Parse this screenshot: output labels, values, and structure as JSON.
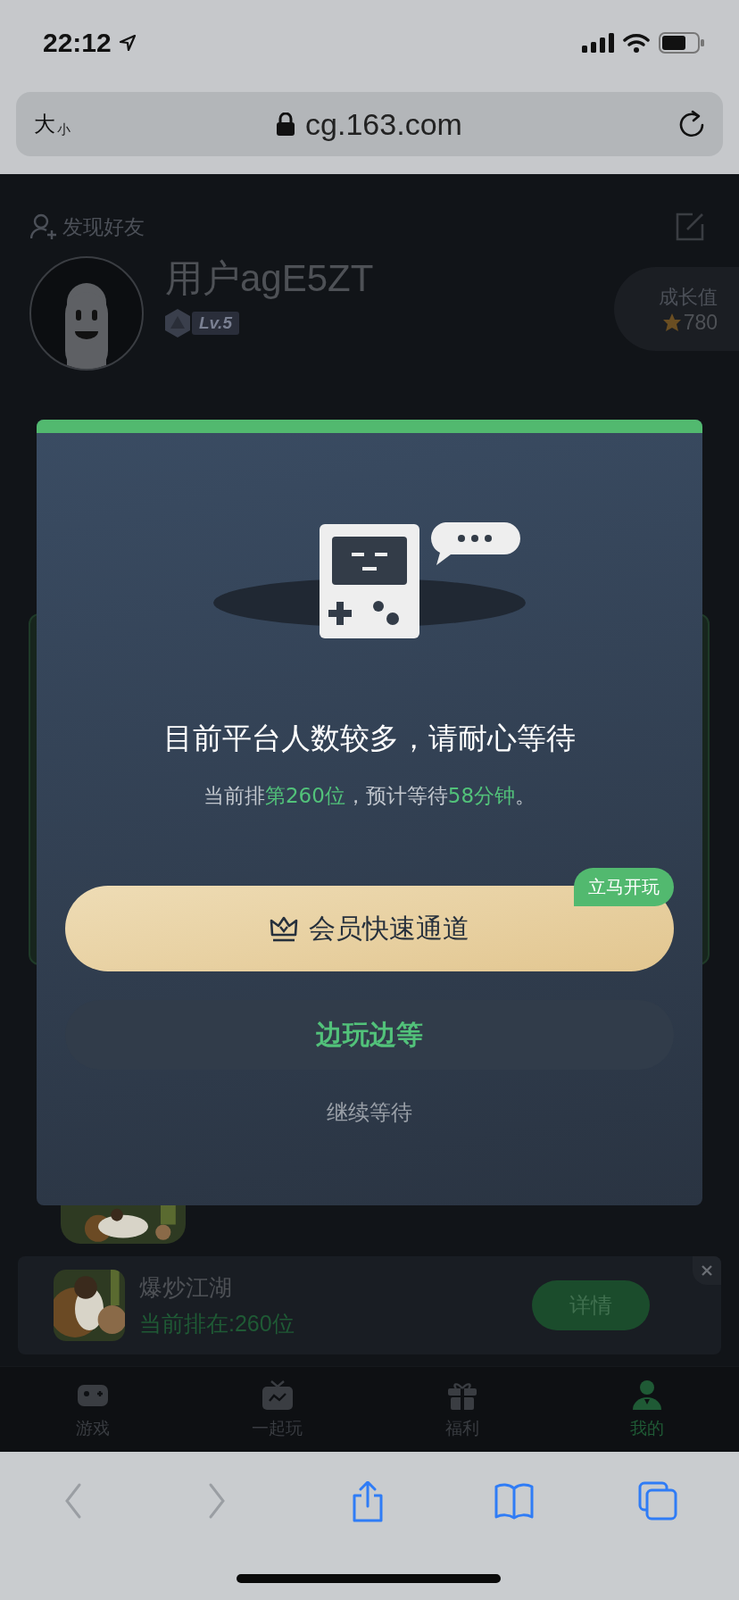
{
  "status_bar": {
    "time": "22:12"
  },
  "browser": {
    "text_size": {
      "large": "大",
      "small": "小"
    },
    "url": "cg.163.com"
  },
  "profile": {
    "find_friends": "发现好友",
    "username": "用户agE5ZT",
    "level": "Lv.5",
    "growth": {
      "label": "成长值",
      "value": "780"
    }
  },
  "dialog": {
    "title": "目前平台人数较多，请耐心等待",
    "message": [
      {
        "text": "当前排",
        "highlight": false
      },
      {
        "text": "第260位",
        "highlight": true
      },
      {
        "text": "，预计等待",
        "highlight": false
      },
      {
        "text": "58分钟",
        "highlight": true
      },
      {
        "text": "。",
        "highlight": false
      }
    ],
    "primary_button": {
      "label": "会员快速通道",
      "badge": "立马开玩"
    },
    "secondary_button": {
      "label": "边玩边等"
    },
    "link": "继续等待"
  },
  "queue_banner": {
    "title": "爆炒江湖",
    "status": "当前排在:260位",
    "button": "详情"
  },
  "tab_bar": [
    {
      "kind": "gamepad",
      "label": "游戏",
      "selected": false
    },
    {
      "kind": "tv",
      "label": "一起玩",
      "selected": false
    },
    {
      "kind": "gift",
      "label": "福利",
      "selected": false
    },
    {
      "kind": "person",
      "label": "我的",
      "selected": true
    }
  ],
  "browser_toolbar": [
    {
      "kind": "back",
      "disabled": true
    },
    {
      "kind": "forward",
      "disabled": true
    },
    {
      "kind": "share",
      "disabled": false
    },
    {
      "kind": "bookmarks",
      "disabled": false
    },
    {
      "kind": "tabs",
      "disabled": false
    }
  ]
}
